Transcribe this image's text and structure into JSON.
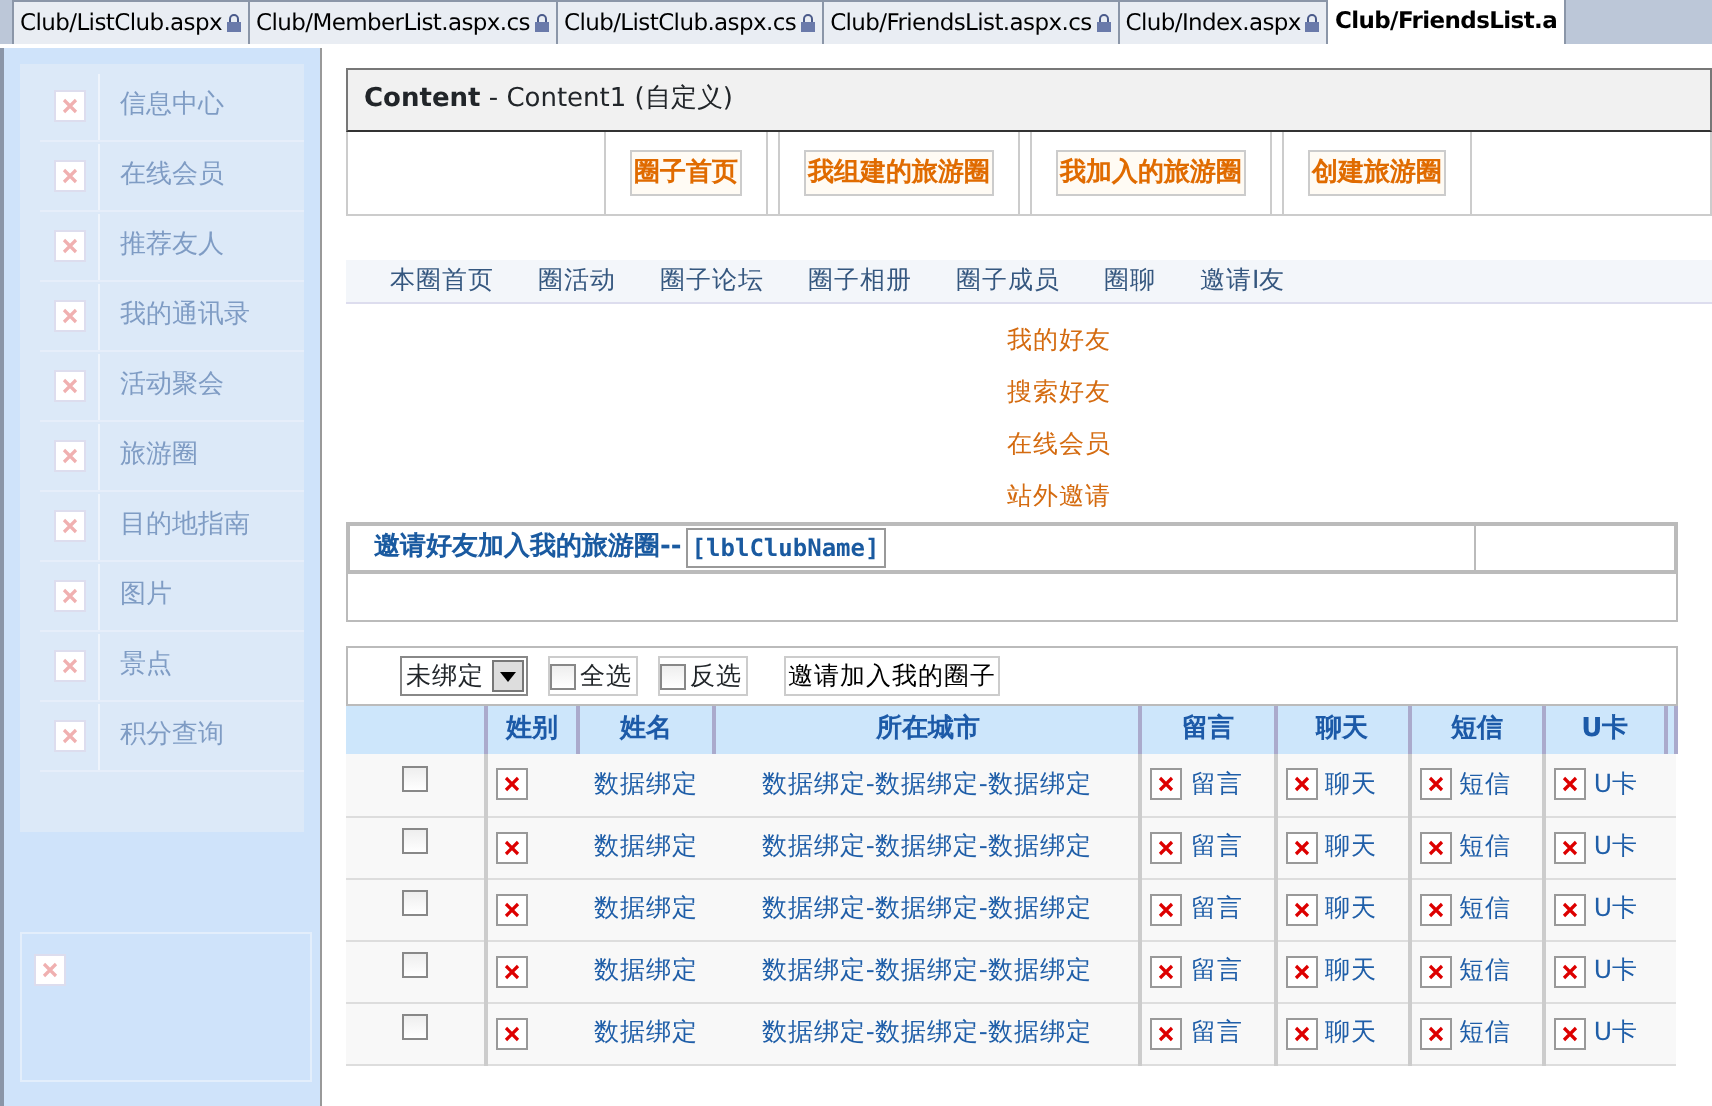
{
  "tabs": [
    {
      "label": "Club/ListClub.aspx",
      "locked": true,
      "selected": false
    },
    {
      "label": "Club/MemberList.aspx.cs",
      "locked": true,
      "selected": false
    },
    {
      "label": "Club/ListClub.aspx.cs",
      "locked": true,
      "selected": false
    },
    {
      "label": "Club/FriendsList.aspx.cs",
      "locked": true,
      "selected": false
    },
    {
      "label": "Club/Index.aspx",
      "locked": true,
      "selected": false
    },
    {
      "label": "Club/FriendsList.a",
      "locked": false,
      "selected": true
    }
  ],
  "sidebar": {
    "items": [
      "信息中心",
      "在线会员",
      "推荐友人",
      "我的通讯录",
      "活动聚会",
      "旅游圈",
      "目的地指南",
      "图片",
      "景点",
      "积分查询"
    ]
  },
  "content": {
    "name": "Content",
    "subtitle": " - Content1 (自定义)"
  },
  "top_buttons": [
    "圈子首页",
    "我组建的旅游圈",
    "我加入的旅游圈",
    "创建旅游圈"
  ],
  "circle_nav": [
    "本圈首页",
    "圈活动",
    "圈子论坛",
    "圈子相册",
    "圈子成员",
    "圈聊",
    "邀请I友"
  ],
  "friend_links": [
    "我的好友",
    "搜索好友",
    "在线会员",
    "站外邀请"
  ],
  "invite": {
    "title": "邀请好友加入我的旅游圈--",
    "label": "[lblClubName]"
  },
  "toolbar": {
    "dropdown": "未绑定",
    "select_all": {
      "label": "全选",
      "checked": false
    },
    "invert": {
      "label": "反选",
      "checked": false
    },
    "button": "邀请加入我的圈子"
  },
  "table": {
    "columns": [
      "姓别",
      "姓名",
      "所在城市",
      "留言",
      "聊天",
      "短信",
      "U卡"
    ],
    "rows": [
      {
        "checked": false,
        "name": "数据绑定",
        "city": "数据绑定-数据绑定-数据绑定",
        "actions": [
          "留言",
          "聊天",
          "短信",
          "U卡"
        ]
      },
      {
        "checked": false,
        "name": "数据绑定",
        "city": "数据绑定-数据绑定-数据绑定",
        "actions": [
          "留言",
          "聊天",
          "短信",
          "U卡"
        ]
      },
      {
        "checked": false,
        "name": "数据绑定",
        "city": "数据绑定-数据绑定-数据绑定",
        "actions": [
          "留言",
          "聊天",
          "短信",
          "U卡"
        ]
      },
      {
        "checked": false,
        "name": "数据绑定",
        "city": "数据绑定-数据绑定-数据绑定",
        "actions": [
          "留言",
          "聊天",
          "短信",
          "U卡"
        ]
      },
      {
        "checked": false,
        "name": "数据绑定",
        "city": "数据绑定-数据绑定-数据绑定",
        "actions": [
          "留言",
          "聊天",
          "短信",
          "U卡"
        ]
      }
    ]
  }
}
